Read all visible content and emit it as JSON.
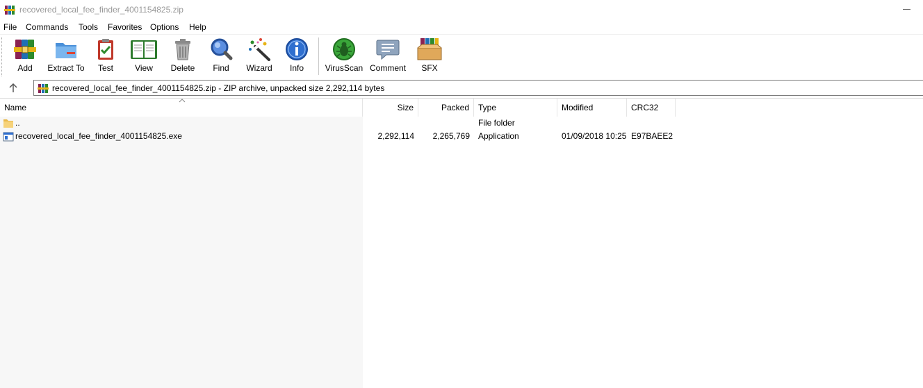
{
  "window": {
    "title": "recovered_local_fee_finder_4001154825.zip"
  },
  "menu": [
    "File",
    "Commands",
    "Tools",
    "Favorites",
    "Options",
    "Help"
  ],
  "toolbar": {
    "add": "Add",
    "extract_to": "Extract To",
    "test": "Test",
    "view": "View",
    "delete": "Delete",
    "find": "Find",
    "wizard": "Wizard",
    "info": "Info",
    "virusscan": "VirusScan",
    "comment": "Comment",
    "sfx": "SFX"
  },
  "address": {
    "text": "recovered_local_fee_finder_4001154825.zip - ZIP archive, unpacked size 2,292,114 bytes"
  },
  "columns": {
    "name": "Name",
    "size": "Size",
    "packed": "Packed",
    "type": "Type",
    "modified": "Modified",
    "crc32": "CRC32"
  },
  "rows": [
    {
      "name": "..",
      "size": "",
      "packed": "",
      "type": "File folder",
      "modified": "",
      "crc32": "",
      "icon": "folder-icon"
    },
    {
      "name": "recovered_local_fee_finder_4001154825.exe",
      "size": "2,292,114",
      "packed": "2,265,769",
      "type": "Application",
      "modified": "01/09/2018 10:25",
      "crc32": "E97BAEE2",
      "icon": "exe-file-icon"
    }
  ],
  "colors": {
    "title_text": "#999999",
    "name_column_shade": "#f7f7f7"
  }
}
